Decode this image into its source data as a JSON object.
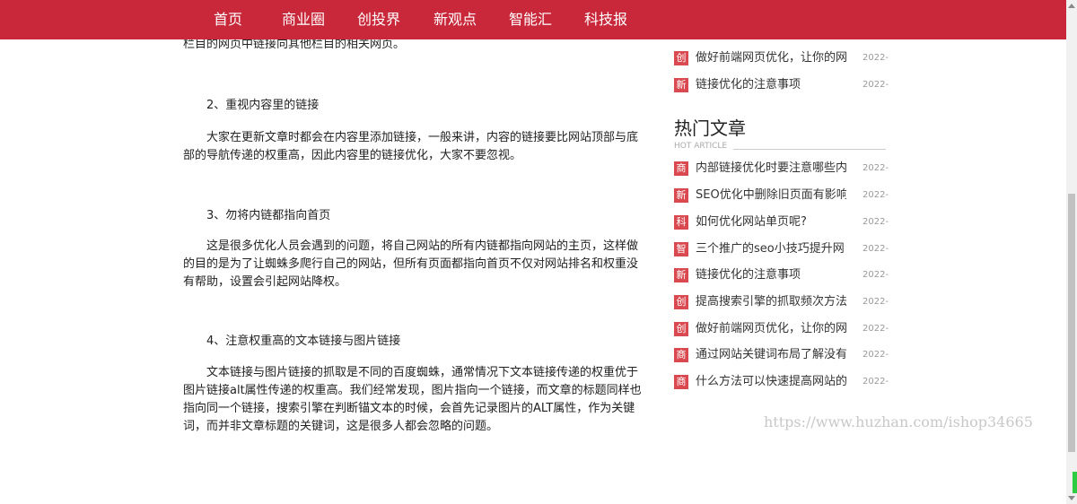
{
  "nav": {
    "items": [
      "首页",
      "商业圈",
      "创投界",
      "新观点",
      "智能汇",
      "科技报"
    ]
  },
  "article": {
    "top_line": "栏目的网页中链接向其他栏目的相关网页。",
    "h2": "2、重视内容里的链接",
    "p2": "大家在更新文章时都会在内容里添加链接，一般来讲，内容的链接要比网站顶部与底部的导航传递的权重高，因此内容里的链接优化，大家不要忽视。",
    "h3": "3、勿将内链都指向首页",
    "p3": "这是很多优化人员会遇到的问题，将自己网站的所有内链都指向网站的主页，这样做的目的是为了让蜘蛛多爬行自己的网站，但所有页面都指向首页不仅对网站排名和权重没有帮助，设置会引起网站降权。",
    "h4": "4、注意权重高的文本链接与图片链接",
    "p4": "文本链接与图片链接的抓取是不同的百度蜘蛛，通常情况下文本链接传递的权重优于图片链接alt属性传递的权重高。我们经常发现，图片指向一个链接，而文章的标题同样也指向同一个链接，搜索引擎在判断锚文本的时候，会首先记录图片的ALT属性，作为关键词，而并非文章标题的关键词，这是很多人都会忽略的问题。"
  },
  "sidebar": {
    "recent": [
      {
        "badge": "创",
        "title": "做好前端网页优化，让你的网",
        "date": "2022-"
      },
      {
        "badge": "新",
        "title": "链接优化的注意事项",
        "date": "2022-"
      }
    ],
    "hot_title": "热门文章",
    "hot_sub": "HOT ARTICLE",
    "hot": [
      {
        "badge": "商",
        "title": "内部链接优化时要注意哪些内",
        "date": "2022-"
      },
      {
        "badge": "新",
        "title": "SEO优化中删除旧页面有影响",
        "date": "2022-"
      },
      {
        "badge": "科",
        "title": "如何优化网站单页呢?",
        "date": "2022-"
      },
      {
        "badge": "智",
        "title": "三个推广的seo小技巧提升网",
        "date": "2022-"
      },
      {
        "badge": "新",
        "title": "链接优化的注意事项",
        "date": "2022-"
      },
      {
        "badge": "创",
        "title": "提高搜索引擎的抓取频次方法",
        "date": "2022-"
      },
      {
        "badge": "创",
        "title": "做好前端网页优化，让你的网",
        "date": "2022-"
      },
      {
        "badge": "商",
        "title": "通过网站关键词布局了解没有",
        "date": "2022-"
      },
      {
        "badge": "商",
        "title": "什么方法可以快速提高网站的",
        "date": "2022-"
      }
    ]
  },
  "watermark": "https://www.huzhan.com/ishop34665",
  "colors": {
    "nav_bg": "#c9283a",
    "badge_bg": "#d9494f"
  }
}
